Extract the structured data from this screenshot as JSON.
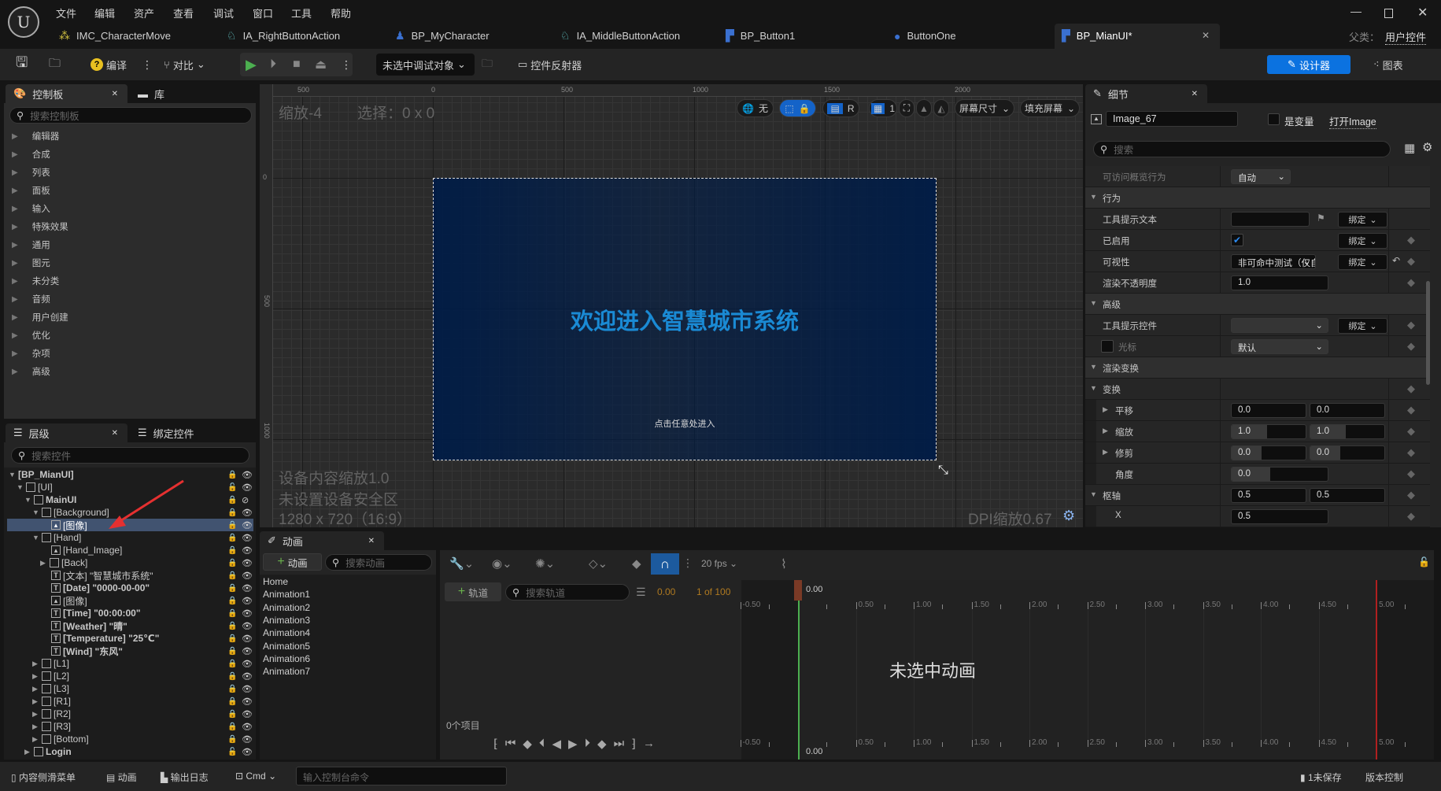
{
  "menu": [
    "文件",
    "编辑",
    "资产",
    "查看",
    "调试",
    "窗口",
    "工具",
    "帮助"
  ],
  "tabs": [
    {
      "label": "IMC_CharacterMove",
      "icon": "input-mapping-icon"
    },
    {
      "label": "IA_RightButtonAction",
      "icon": "input-action-icon"
    },
    {
      "label": "BP_MyCharacter",
      "icon": "character-icon"
    },
    {
      "label": "IA_MiddleButtonAction",
      "icon": "input-action-icon"
    },
    {
      "label": "BP_Button1",
      "icon": "widget-blueprint-icon"
    },
    {
      "label": "ButtonOne",
      "icon": "blueprint-icon"
    },
    {
      "label": "BP_MianUI*",
      "icon": "widget-blueprint-icon",
      "active": true
    }
  ],
  "parent_class": {
    "label": "父类：",
    "value": "用户控件"
  },
  "toolbar": {
    "compile": "编译",
    "diff": "对比",
    "debug_target": "未选中调试对象",
    "widget_reflector": "控件反射器",
    "designer": "设计器",
    "graph": "图表"
  },
  "palette": {
    "tab": "控制板",
    "library_tab": "库",
    "search_placeholder": "搜索控制板",
    "items": [
      "编辑器",
      "合成",
      "列表",
      "面板",
      "输入",
      "特殊效果",
      "通用",
      "图元",
      "未分类",
      "音频",
      "用户创建",
      "优化",
      "杂项",
      "高级"
    ]
  },
  "hierarchy": {
    "tab": "层级",
    "bind_tab": "绑定控件",
    "search_placeholder": "搜索控件",
    "rows": [
      {
        "label": "[BP_MianUI]",
        "level": 0,
        "toggle": "open",
        "icon": "none",
        "bold": true
      },
      {
        "label": "[UI]",
        "level": 1,
        "toggle": "open",
        "icon": "panel",
        "lock": "unlocked"
      },
      {
        "label": "MainUI",
        "level": 2,
        "toggle": "open",
        "icon": "panel",
        "bold": true,
        "hidden": true
      },
      {
        "label": "[Background]",
        "level": 3,
        "toggle": "open",
        "icon": "panel"
      },
      {
        "label": "[图像]",
        "level": 4,
        "icon": "image",
        "selected": true
      },
      {
        "label": "[Hand]",
        "level": 3,
        "toggle": "open",
        "icon": "panel"
      },
      {
        "label": "[Hand_Image]",
        "level": 4,
        "icon": "image"
      },
      {
        "label": "[Back]",
        "level": 4,
        "toggle": "closed",
        "icon": "panel"
      },
      {
        "label": "[文本] \"智慧城市系统\"",
        "level": 4,
        "icon": "text"
      },
      {
        "label": "[Date] \"0000-00-00\"",
        "level": 4,
        "icon": "text",
        "bold": true
      },
      {
        "label": "[图像]",
        "level": 4,
        "icon": "image"
      },
      {
        "label": "[Time] \"00:00:00\"",
        "level": 4,
        "icon": "text",
        "bold": true
      },
      {
        "label": "[Weather] \"晴\"",
        "level": 4,
        "icon": "text",
        "bold": true
      },
      {
        "label": "[Temperature] \"25℃\"",
        "level": 4,
        "icon": "text",
        "bold": true
      },
      {
        "label": "[Wind] \"东风\"",
        "level": 4,
        "icon": "text",
        "bold": true
      },
      {
        "label": "[L1]",
        "level": 3,
        "toggle": "closed",
        "icon": "panel"
      },
      {
        "label": "[L2]",
        "level": 3,
        "toggle": "closed",
        "icon": "panel"
      },
      {
        "label": "[L3]",
        "level": 3,
        "toggle": "closed",
        "icon": "panel"
      },
      {
        "label": "[R1]",
        "level": 3,
        "toggle": "closed",
        "icon": "panel"
      },
      {
        "label": "[R2]",
        "level": 3,
        "toggle": "closed",
        "icon": "panel"
      },
      {
        "label": "[R3]",
        "level": 3,
        "toggle": "closed",
        "icon": "panel"
      },
      {
        "label": "[Bottom]",
        "level": 3,
        "toggle": "closed",
        "icon": "panel"
      },
      {
        "label": "Login",
        "level": 2,
        "toggle": "closed",
        "icon": "panel",
        "bold": true,
        "lock": "unlocked"
      }
    ]
  },
  "designer": {
    "zoom": "缩放-4",
    "selection": "选择：0 x 0",
    "ruler_top": [
      "500",
      "0",
      "500",
      "1000",
      "1500",
      "2000"
    ],
    "ruler_left": [
      "0",
      "500",
      "1000"
    ],
    "none_label": "无",
    "r_label": "R",
    "grid_count": "1",
    "screen_size": "屏幕尺寸",
    "fill_screen": "填充屏幕",
    "title_text": "欢迎进入智慧城市系统",
    "hint_text": "点击任意处进入",
    "title_color": "#1a8ad4",
    "background_color": "#001c46",
    "device_scale": "设备内容缩放1.0",
    "safe_zone": "未设置设备安全区",
    "resolution": "1280 x 720（16:9）",
    "dpi": "DPI缩放0.67"
  },
  "details": {
    "tab": "细节",
    "name": "Image_67",
    "is_variable": "是变量",
    "open_link": "打开Image",
    "search_placeholder": "搜索",
    "accessible_label": "可访问概览行为",
    "accessible_value": "自动",
    "bind": "绑定",
    "sections": {
      "behavior": "行为",
      "advanced": "高级",
      "render_transform": "渲染变换",
      "transform": "变换",
      "pivot": "枢轴"
    },
    "tooltip_text": "工具提示文本",
    "tooltip_text_value": "",
    "enabled": "已启用",
    "enabled_checked": true,
    "visibility": "可视性",
    "visibility_value": "非可命中测试（仅自身）",
    "opacity": "渲染不透明度",
    "opacity_value": "1.0",
    "tooltip_widget": "工具提示控件",
    "cursor": "光标",
    "cursor_value": "默认",
    "translation": "平移",
    "translation_x": "0.0",
    "translation_y": "0.0",
    "scale": "缩放",
    "scale_x": "1.0",
    "scale_y": "1.0",
    "shear": "修剪",
    "shear_x": "0.0",
    "shear_y": "0.0",
    "angle": "角度",
    "angle_value": "0.0",
    "pivot_x": "0.5",
    "pivot_y": "0.5",
    "x_label": "X",
    "x_value": "0.5"
  },
  "animation": {
    "tab": "动画",
    "add": "动画",
    "search_placeholder": "搜索动画",
    "items": [
      "Home",
      "Animation1",
      "Animation2",
      "Animation3",
      "Animation4",
      "Animation5",
      "Animation6",
      "Animation7"
    ],
    "fps": "20 fps",
    "add_track": "轨道",
    "track_search_placeholder": "搜索轨道",
    "current_time": "0.00",
    "frame": "1 of 100",
    "item_count": "0个项目",
    "empty": "未选中动画",
    "playhead": "0.00",
    "ticks": [
      "-0.50",
      "0.00",
      "0.50",
      "1.00",
      "1.50",
      "2.00",
      "2.50",
      "3.00",
      "3.50",
      "4.00",
      "4.50",
      "5.00"
    ]
  },
  "statusbar": {
    "content_drawer": "内容侧滑菜单",
    "animation": "动画",
    "output_log": "输出日志",
    "cmd": "Cmd",
    "cmd_placeholder": "输入控制台命令",
    "unsaved": "1未保存",
    "source_control": "版本控制"
  }
}
